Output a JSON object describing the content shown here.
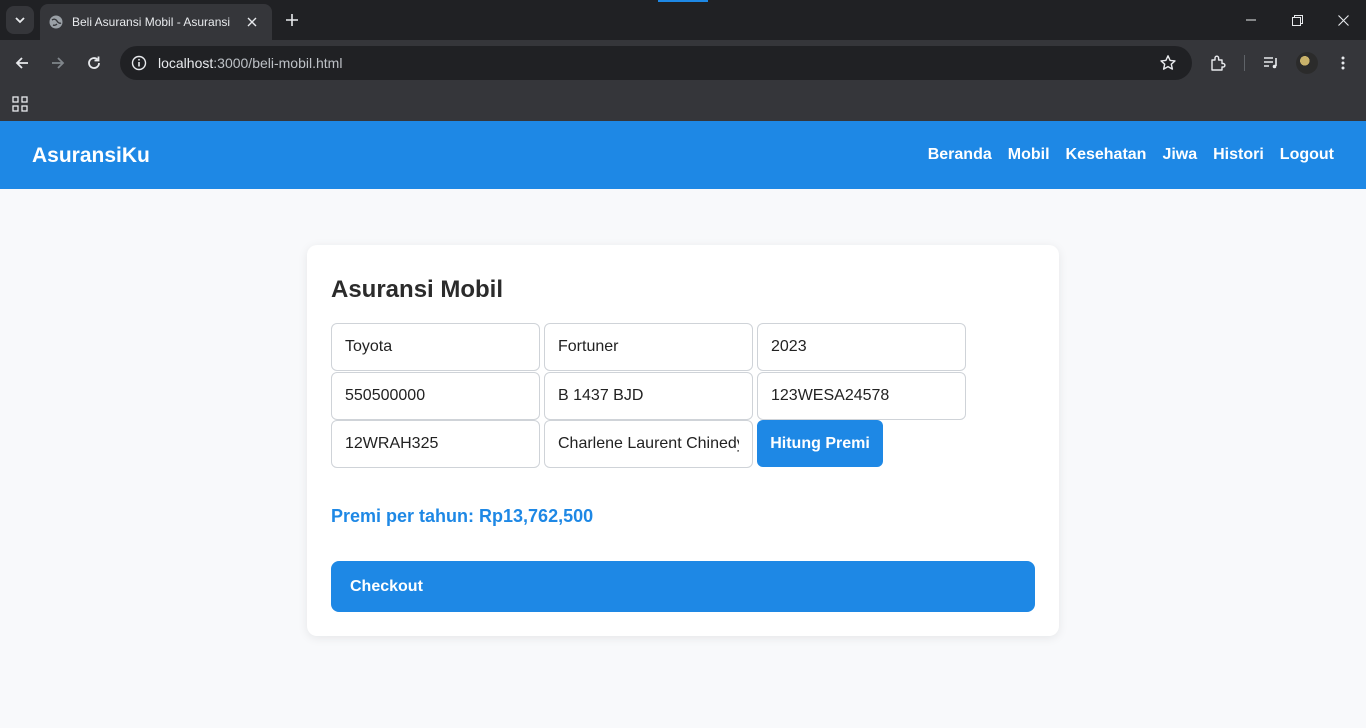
{
  "browser": {
    "tab_title": "Beli Asuransi Mobil - Asuransi",
    "url_host": "localhost",
    "url_path": ":3000/beli-mobil.html"
  },
  "navbar": {
    "brand": "AsuransiKu",
    "links": [
      "Beranda",
      "Mobil",
      "Kesehatan",
      "Jiwa",
      "Histori",
      "Logout"
    ]
  },
  "form": {
    "title": "Asuransi Mobil",
    "fields": [
      "Toyota",
      "Fortuner",
      "2023",
      "550500000",
      "B 1437 BJD",
      "123WESA24578",
      "12WRAH325",
      "Charlene Laurent Chinedy"
    ],
    "calculate_label": "Hitung Premi",
    "premium_text": "Premi per tahun: Rp13,762,500",
    "checkout_label": "Checkout"
  },
  "colors": {
    "primary": "#1e88e5",
    "chrome_dark": "#202124",
    "chrome_toolbar": "#35363a"
  }
}
